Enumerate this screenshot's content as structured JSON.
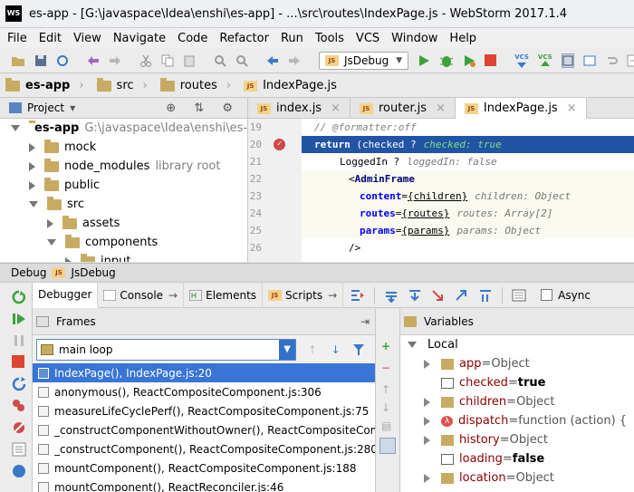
{
  "window": {
    "title": "es-app - [G:\\javaspace\\Idea\\enshi\\es-app] - ...\\src\\routes\\IndexPage.js - WebStorm 2017.1.4",
    "logo": "WS"
  },
  "menu": [
    "File",
    "Edit",
    "View",
    "Navigate",
    "Code",
    "Refactor",
    "Run",
    "Tools",
    "VCS",
    "Window",
    "Help"
  ],
  "toolbar": {
    "run_config": "JsDebug",
    "vcs1": "VCS",
    "vcs2": "VCS"
  },
  "breadcrumbs": [
    "es-app",
    "src",
    "routes",
    "IndexPage.js"
  ],
  "project": {
    "header": "Project",
    "tree": [
      {
        "name": "es-app",
        "note": "G:\\javaspace\\Idea\\enshi\\es-ap"
      },
      {
        "name": "mock",
        "note": ""
      },
      {
        "name": "node_modules",
        "note": "library root"
      },
      {
        "name": "public",
        "note": ""
      },
      {
        "name": "src",
        "note": ""
      },
      {
        "name": "assets",
        "note": ""
      },
      {
        "name": "components",
        "note": ""
      },
      {
        "name": "input",
        "note": ""
      }
    ]
  },
  "editor": {
    "tabs": [
      "index.js",
      "router.js",
      "IndexPage.js"
    ],
    "lines": [
      "19",
      "20",
      "21",
      "22",
      "23",
      "24",
      "25",
      "26"
    ],
    "code": {
      "l19": "// @formatter:off",
      "l20_kw": "return",
      "l20_text": " (checked ?",
      "l20_hint": "checked: true",
      "l21_text": "LoggedIn ?",
      "l21_hint": "loggedIn: false",
      "l22_tag": "AdminFrame",
      "l23_attr": "content",
      "l23_val": "children",
      "l23_hint": "children: Object",
      "l24_attr": "routes",
      "l24_val": "routes",
      "l24_hint": "routes: Array[2]",
      "l25_attr": "params",
      "l25_val": "params",
      "l25_hint": "params: Object",
      "l26": "/>"
    }
  },
  "debug": {
    "title": "Debug",
    "config": "JsDebug",
    "tabs": [
      "Debugger",
      "Console",
      "Elements",
      "Scripts"
    ],
    "async_label": "Async",
    "frames_label": "Frames",
    "thread": "main loop",
    "frames": [
      "IndexPage(), IndexPage.js:20",
      "anonymous(), ReactCompositeComponent.js:306",
      "measureLifeCyclePerf(), ReactCompositeComponent.js:75",
      "_constructComponentWithoutOwner(), ReactCompositeCompo",
      "_constructComponent(), ReactCompositeComponent.js:280",
      "mountComponent(), ReactCompositeComponent.js:188",
      "mountComponent(), ReactReconciler.js:46"
    ],
    "variables_label": "Variables",
    "scope": "Local",
    "variables": [
      {
        "name": "app",
        "eq": " = ",
        "value": "Object",
        "bold": false
      },
      {
        "name": "checked",
        "eq": " = ",
        "value": "true",
        "bold": true
      },
      {
        "name": "children",
        "eq": " = ",
        "value": "Object",
        "bold": false
      },
      {
        "name": "dispatch",
        "eq": " = ",
        "value": "function (action) {",
        "bold": false
      },
      {
        "name": "history",
        "eq": " = ",
        "value": "Object",
        "bold": false
      },
      {
        "name": "loading",
        "eq": " = ",
        "value": "false",
        "bold": true
      },
      {
        "name": "location",
        "eq": " = ",
        "value": "Object",
        "bold": false
      }
    ]
  },
  "colors": {
    "selection": "#3875d6",
    "exec_line": "#2154a4",
    "run_green": "#3ba13b",
    "stop_red": "#dd4433"
  }
}
